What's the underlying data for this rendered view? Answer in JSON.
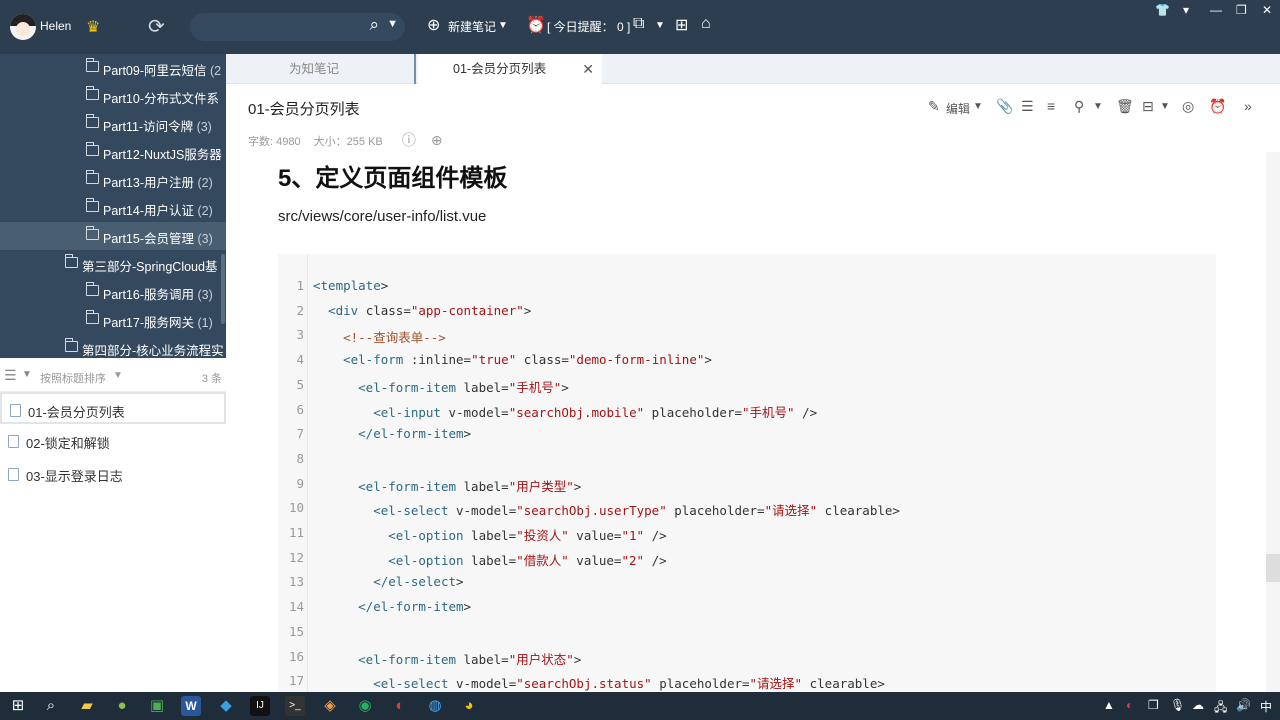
{
  "user": {
    "name": "Helen"
  },
  "toolbar": {
    "new_note": "新建笔记",
    "reminder": "[ 今日提醒： 0 ]"
  },
  "sidebar": {
    "items": [
      {
        "label": "Part09-阿里云短信",
        "count": "(2"
      },
      {
        "label": "Part10-分布式文件系",
        "count": ""
      },
      {
        "label": "Part11-访问令牌",
        "count": "(3)"
      },
      {
        "label": "Part12-NuxtJS服务器",
        "count": ""
      },
      {
        "label": "Part13-用户注册",
        "count": "(2)"
      },
      {
        "label": "Part14-用户认证",
        "count": "(2)"
      },
      {
        "label": "Part15-会员管理",
        "count": "(3)"
      },
      {
        "label": "第三部分-SpringCloud基",
        "count": ""
      },
      {
        "label": "Part16-服务调用",
        "count": "(3)"
      },
      {
        "label": "Part17-服务网关",
        "count": "(1)"
      },
      {
        "label": "第四部分-核心业务流程实",
        "count": ""
      }
    ]
  },
  "list": {
    "sort_label": "按照标题排序",
    "count": "3 条",
    "notes": [
      "01-会员分页列表",
      "02-锁定和解锁",
      "03-显示登录日志"
    ]
  },
  "tabs": [
    "为知笔记",
    "01-会员分页列表"
  ],
  "doc": {
    "title": "01-会员分页列表",
    "words": "字数: 4980",
    "size": "大小：255 KB",
    "edit_label": "编辑",
    "heading": "5、定义页面组件模板",
    "path": "src/views/core/user-info/list.vue"
  },
  "code_lines": [
    "<template>",
    "  <div class=\"app-container\">",
    "    <!--查询表单-->",
    "    <el-form :inline=\"true\" class=\"demo-form-inline\">",
    "      <el-form-item label=\"手机号\">",
    "        <el-input v-model=\"searchObj.mobile\" placeholder=\"手机号\" />",
    "      </el-form-item>",
    "",
    "      <el-form-item label=\"用户类型\">",
    "        <el-select v-model=\"searchObj.userType\" placeholder=\"请选择\" clearable>",
    "          <el-option label=\"投资人\" value=\"1\" />",
    "          <el-option label=\"借款人\" value=\"2\" />",
    "        </el-select>",
    "      </el-form-item>",
    "",
    "      <el-form-item label=\"用户状态\">",
    "        <el-select v-model=\"searchObj.status\" placeholder=\"请选择\" clearable>"
  ],
  "taskbar": {
    "ime": "中"
  }
}
